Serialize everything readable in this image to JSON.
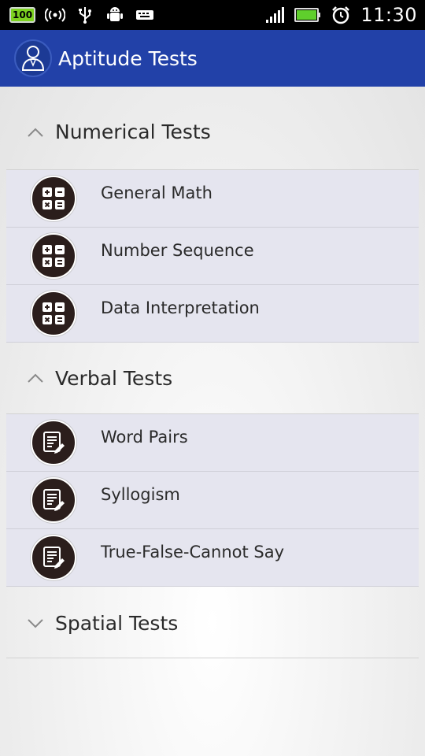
{
  "status_bar": {
    "battery_badge": "100",
    "time": "11:30",
    "icons": [
      "battery-badge-icon",
      "wireless-hotspot-icon",
      "usb-icon",
      "android-debug-icon",
      "keyboard-icon",
      "signal-icon",
      "battery-icon",
      "alarm-icon"
    ]
  },
  "app_bar": {
    "title": "Aptitude Tests",
    "logo_icon": "person-avatar-icon",
    "color": "#2241a8"
  },
  "groups": [
    {
      "title": "Numerical Tests",
      "expanded": true,
      "icon": "calculator-icon",
      "items": [
        {
          "label": "General Math"
        },
        {
          "label": "Number Sequence"
        },
        {
          "label": "Data Interpretation"
        }
      ]
    },
    {
      "title": "Verbal Tests",
      "expanded": true,
      "icon": "document-edit-icon",
      "items": [
        {
          "label": "Word Pairs"
        },
        {
          "label": "Syllogism"
        },
        {
          "label": "True-False-Cannot Say"
        }
      ]
    },
    {
      "title": "Spatial Tests",
      "expanded": false,
      "items": []
    }
  ]
}
